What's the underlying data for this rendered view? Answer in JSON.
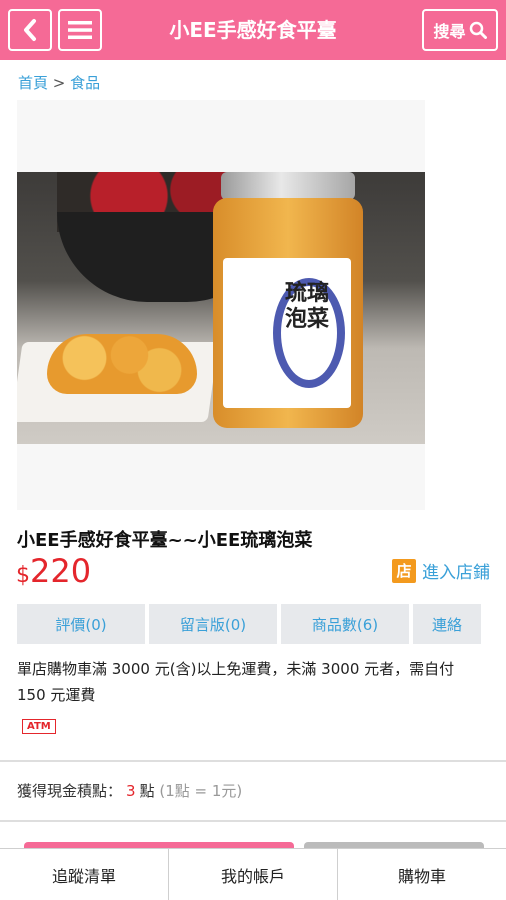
{
  "header": {
    "title": "小EE手感好食平臺",
    "back_icon": "chevron-left-icon",
    "menu_icon": "hamburger-icon",
    "search_label": "搜尋",
    "search_icon": "search-icon",
    "brand_color": "#f56a96"
  },
  "breadcrumb": {
    "home": "首頁",
    "separator": ">",
    "category": "食品"
  },
  "product": {
    "image_label_text": "琉璃泡菜",
    "title": "小EE手感好食平臺~~小EE琉璃泡菜",
    "currency": "$",
    "price": "220",
    "shop_icon_text": "店",
    "enter_shop": "進入店鋪",
    "price_color": "#e4262c",
    "link_color": "#3aa0d8"
  },
  "tabs": [
    {
      "label": "評價(0)"
    },
    {
      "label": "留言版(0)"
    },
    {
      "label": "商品數(6)"
    },
    {
      "label": "連絡"
    }
  ],
  "shipping": {
    "text": "單店購物車滿 3000 元(含)以上免運費，未滿 3000 元者，需自付 150 元運費",
    "payment_badge": "ATM"
  },
  "points": {
    "prefix": "獲得現金積點：",
    "value": "3",
    "unit": "點",
    "note": "(1點 = 1元)"
  },
  "bottom_nav": [
    {
      "label": "追蹤清單"
    },
    {
      "label": "我的帳戶"
    },
    {
      "label": "購物車"
    }
  ]
}
